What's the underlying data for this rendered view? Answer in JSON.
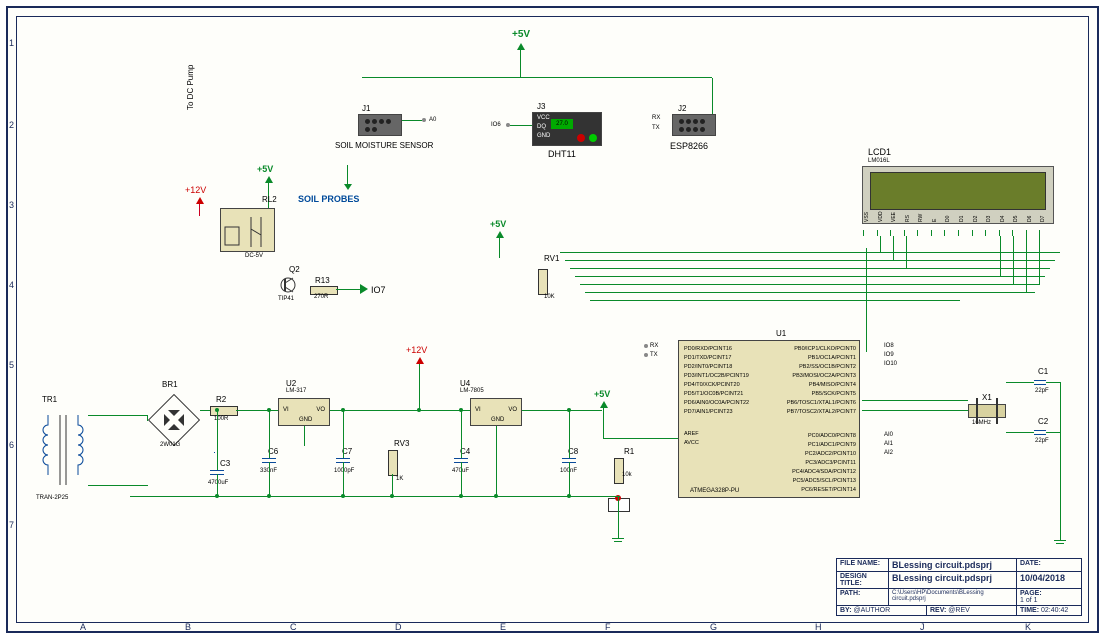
{
  "page": {
    "ruler_top": [
      "1",
      "2",
      "3",
      "4",
      "5",
      "6",
      "7"
    ],
    "ruler_bottom": [
      "A",
      "B",
      "C",
      "D",
      "E",
      "F",
      "G",
      "H",
      "J",
      "K"
    ],
    "ruler_left": [
      "1",
      "2",
      "3",
      "4",
      "5",
      "6",
      "7"
    ]
  },
  "title_block": {
    "file_name_label": "FILE NAME:",
    "file_name": "BLessing circuit.pdsprj",
    "design_title_label": "DESIGN TITLE:",
    "design_title": "BLessing circuit.pdsprj",
    "path_label": "PATH:",
    "path": "C:\\Users\\HP\\Documents\\BLessing circuit.pdsprj",
    "by_label": "BY:",
    "by": "@AUTHOR",
    "rev_label": "REV:",
    "rev": "@REV",
    "date_label": "DATE:",
    "date": "10/04/2018",
    "page_label": "PAGE:",
    "page": "1 of 1",
    "time_label": "TIME:",
    "time": "02:40:42"
  },
  "components": {
    "tr1": {
      "ref": "TR1",
      "part": "TRAN-2P25"
    },
    "br1": {
      "ref": "BR1",
      "part": "2W01G"
    },
    "r2": {
      "ref": "R2",
      "val": "100R"
    },
    "u2": {
      "ref": "U2",
      "part": "LM-317",
      "pins": [
        "VI",
        "VO",
        "GND"
      ]
    },
    "c3": {
      "ref": "C3",
      "val": "4700uF"
    },
    "c6": {
      "ref": "C6",
      "val": "330nF"
    },
    "c7": {
      "ref": "C7",
      "val": "1000pF"
    },
    "c4": {
      "ref": "C4",
      "val": "470uF"
    },
    "c8": {
      "ref": "C8",
      "val": "100nF"
    },
    "rv3": {
      "ref": "RV3",
      "val": "1K"
    },
    "u4": {
      "ref": "U4",
      "part": "LM-7805",
      "pins": [
        "VI",
        "VO",
        "GND"
      ]
    },
    "r1": {
      "ref": "R1",
      "val": "10k"
    },
    "rv1": {
      "ref": "RV1",
      "val": "10K"
    },
    "u1": {
      "ref": "U1",
      "part": "ATMEGA328P-PU",
      "left_top": [
        "PD0/RXD/PCINT16",
        "PD1/TXD/PCINT17",
        "PD2/INT0/PCINT18",
        "PD3/INT1/OC2B/PCINT19",
        "PD4/T0/XCK/PCINT20",
        "PD5/T1/OC0B/PCINT21",
        "PD6/AIN0/OC0A/PCINT22",
        "PD7/AIN1/PCINT23"
      ],
      "left_bot": [
        "AREF",
        "AVCC"
      ],
      "right_top": [
        "PB0/ICP1/CLKO/PCINT0",
        "PB1/OC1A/PCINT1",
        "PB2/SS/OC1B/PCINT2",
        "PB3/MOSI/OC2A/PCINT3",
        "PB4/MISO/PCINT4",
        "PB5/SCK/PCINT5",
        "PB6/TOSC1/XTAL1/PCINT6",
        "PB7/TOSC2/XTAL2/PCINT7"
      ],
      "right_bot": [
        "PC0/ADC0/PCINT8",
        "PC1/ADC1/PCINT9",
        "PC2/ADC2/PCINT10",
        "PC3/ADC3/PCINT11",
        "PC4/ADC4/SDA/PCINT12",
        "PC5/ADC5/SCL/PCINT13",
        "PC6/RESET/PCINT14"
      ],
      "io_left": [
        "RX",
        "TX"
      ],
      "io_right_top": [
        "IO8",
        "IO9",
        "IO10"
      ],
      "io_right_bot": [
        "AI0",
        "AI1",
        "AI2"
      ]
    },
    "lcd1": {
      "ref": "LCD1",
      "part": "LM016L",
      "pins_bot": [
        "VSS",
        "VDD",
        "VEE",
        "RS",
        "RW",
        "E",
        "D0",
        "D1",
        "D2",
        "D3",
        "D4",
        "D5",
        "D6",
        "D7"
      ]
    },
    "x1": {
      "ref": "X1",
      "part": "CRYSTAL",
      "freq": "16MHz"
    },
    "c1": {
      "ref": "C1",
      "val": "22pF"
    },
    "c2": {
      "ref": "C2",
      "val": "22pF"
    },
    "j1": {
      "ref": "J1",
      "name": "SOIL MOISTURE SENSOR",
      "right_pin": "A0"
    },
    "j2": {
      "ref": "J2",
      "name": "ESP8266",
      "pins": [
        "RX",
        "TX"
      ]
    },
    "j3": {
      "ref": "J3",
      "name": "DHT11",
      "pins": [
        "VCC",
        "DQ",
        "GND"
      ],
      "temp": "27.0",
      "left_pin": "IO6"
    },
    "rl2": {
      "ref": "RL2",
      "part": "DC-5V"
    },
    "q2": {
      "ref": "Q2",
      "part": "TIP41"
    },
    "r13": {
      "ref": "R13",
      "val": "270R",
      "io": "IO7"
    },
    "labels": {
      "to_dc_pump": "To DC Pump",
      "soil_probes": "SOIL PROBES",
      "p5v": "+5V",
      "p12v": "+12V"
    }
  }
}
